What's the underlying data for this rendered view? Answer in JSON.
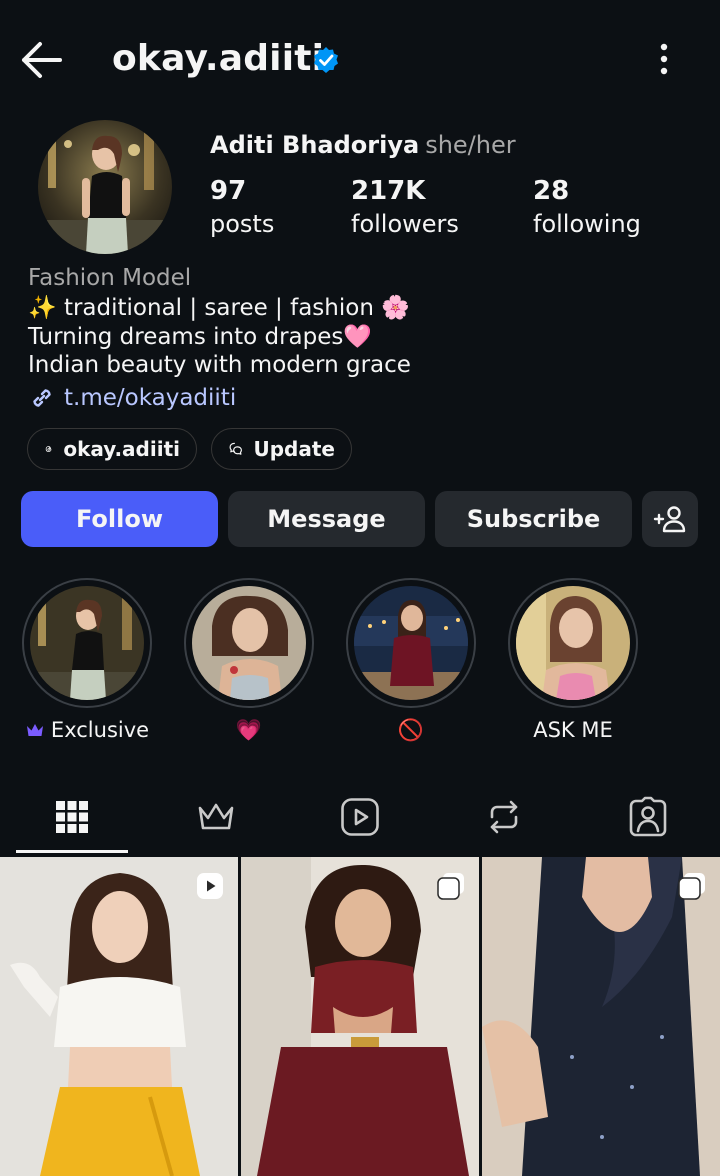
{
  "header": {
    "username": "okay.adiiti",
    "back_icon": "arrow-left-icon",
    "verified_icon": "verified-badge-icon",
    "more_icon": "more-vertical-icon"
  },
  "profile": {
    "full_name": "Aditi Bhadoriya",
    "pronouns": "she/her",
    "stats": {
      "posts": {
        "value": "97",
        "label": "posts"
      },
      "followers": {
        "value": "217K",
        "label": "followers"
      },
      "following": {
        "value": "28",
        "label": "following"
      }
    },
    "category": "Fashion Model",
    "bio": [
      "✨ traditional | saree | fashion 🌸",
      "Turning dreams into drapes🩷",
      "Indian beauty with modern grace"
    ],
    "link": "t.me/okayadiiti"
  },
  "chips": {
    "threads": "okay.adiiti",
    "update": "Update"
  },
  "actions": {
    "follow": "Follow",
    "message": "Message",
    "subscribe": "Subscribe",
    "suggest_icon": "add-person-icon"
  },
  "highlights": [
    {
      "label": "Exclusive",
      "icon": "crown-icon"
    },
    {
      "label": "💗"
    },
    {
      "label": "🚫"
    },
    {
      "label": "ASK ME"
    }
  ],
  "tabs": [
    {
      "name": "grid",
      "icon": "grid-icon",
      "active": true
    },
    {
      "name": "subscriptions",
      "icon": "crown-icon"
    },
    {
      "name": "reels",
      "icon": "reels-icon"
    },
    {
      "name": "reposts",
      "icon": "repost-icon"
    },
    {
      "name": "tagged",
      "icon": "tagged-icon"
    }
  ],
  "posts": [
    {
      "type": "reel",
      "badge_icon": "reel-badge-icon"
    },
    {
      "type": "carousel",
      "badge_icon": "carousel-badge-icon"
    },
    {
      "type": "carousel",
      "badge_icon": "carousel-badge-icon"
    }
  ],
  "colors": {
    "background": "#0c1014",
    "follow_button": "#4a5df9",
    "secondary_button": "#25292e",
    "link": "#b9c7ff",
    "verified": "#0095f6",
    "muted_text": "#a8a8a8"
  }
}
